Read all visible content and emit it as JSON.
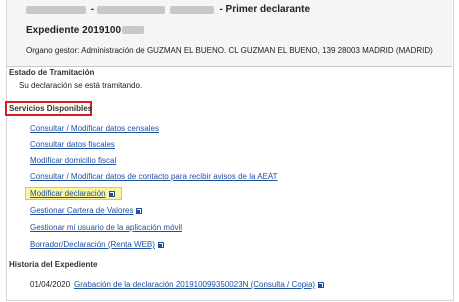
{
  "header": {
    "role": "- Primer declarante",
    "expediente_label": "Expediente 2019100",
    "organo_gestor": "Organo gestor: Administración de GUZMAN EL BUENO.  CL GUZMAN EL BUENO, 139 28003 MADRID (MADRID)"
  },
  "estado": {
    "title": "Estado de Tramitación",
    "text": "Su declaración se está tramitando."
  },
  "servicios": {
    "title": "Servicios Disponibles",
    "links": [
      "Consultar / Modificar datos censales",
      "Consultar datos fiscales",
      "Modificar domicilio fiscal",
      "Consultar / Modificar datos de contacto para recibir avisos de la AEAT",
      "Modificar declaración",
      "Gestionar Cartera de Valores",
      "Gestionar mi usuario de la aplicación móvil",
      "Borrador/Declaración (Renta WEB)"
    ]
  },
  "historia": {
    "title": "Historia del Expediente",
    "date": "01/04/2020",
    "entry": "Grabación de la declaración 201910099350023N (Consulta / Copia)"
  },
  "colors": {
    "link": "#1f4fa3",
    "highlight_box": "#d91e1e",
    "highlight_fill": "#fbf59b"
  }
}
